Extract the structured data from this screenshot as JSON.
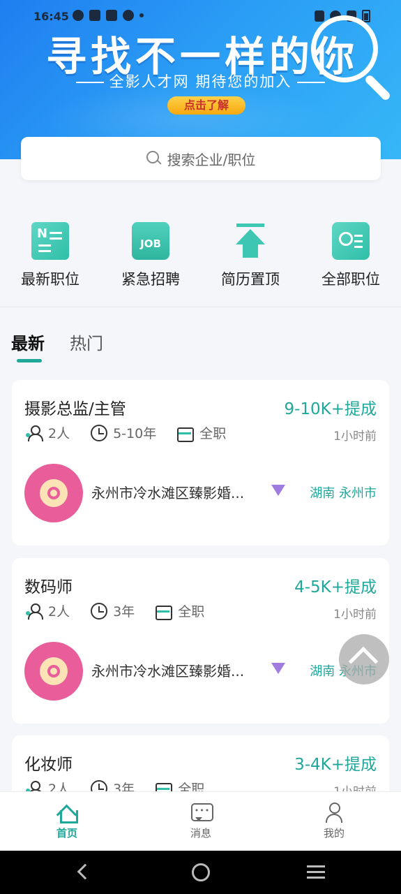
{
  "status_bar": {
    "time": "16:45"
  },
  "banner": {
    "title": "寻找不一样的你",
    "subtitle": "全影人才网 期待您的加入",
    "cta": "点击了解"
  },
  "search": {
    "placeholder": "搜索企业/职位"
  },
  "quick_menu": [
    {
      "label": "最新职位",
      "icon": "news-icon"
    },
    {
      "label": "紧急招聘",
      "icon": "urgent-job-icon",
      "badge": "JOB"
    },
    {
      "label": "简历置顶",
      "icon": "arrow-top-icon"
    },
    {
      "label": "全部职位",
      "icon": "contact-card-icon"
    }
  ],
  "tabs": [
    {
      "label": "最新",
      "active": true
    },
    {
      "label": "热门",
      "active": false
    }
  ],
  "jobs": [
    {
      "title": "摄影总监/主管",
      "salary": "9-10K+提成",
      "headcount": "2人",
      "experience": "5-10年",
      "type": "全职",
      "posted": "1小时前",
      "company": "永州市冷水滩区臻影婚...",
      "location": "湖南 永州市"
    },
    {
      "title": "数码师",
      "salary": "4-5K+提成",
      "headcount": "2人",
      "experience": "3年",
      "type": "全职",
      "posted": "1小时前",
      "company": "永州市冷水滩区臻影婚...",
      "location": "湖南 永州市"
    },
    {
      "title": "化妆师",
      "salary": "3-4K+提成",
      "headcount": "2人",
      "experience": "3年",
      "type": "全职",
      "posted": "1小时前"
    }
  ],
  "bottom_nav": [
    {
      "label": "首页",
      "icon": "home-icon",
      "active": true
    },
    {
      "label": "消息",
      "icon": "message-icon",
      "active": false
    },
    {
      "label": "我的",
      "icon": "profile-icon",
      "active": false
    }
  ],
  "colors": {
    "accent": "#1fa89a",
    "banner": "#2a9cf5",
    "logo": "#e85d9a",
    "vip": "#a07be0"
  }
}
